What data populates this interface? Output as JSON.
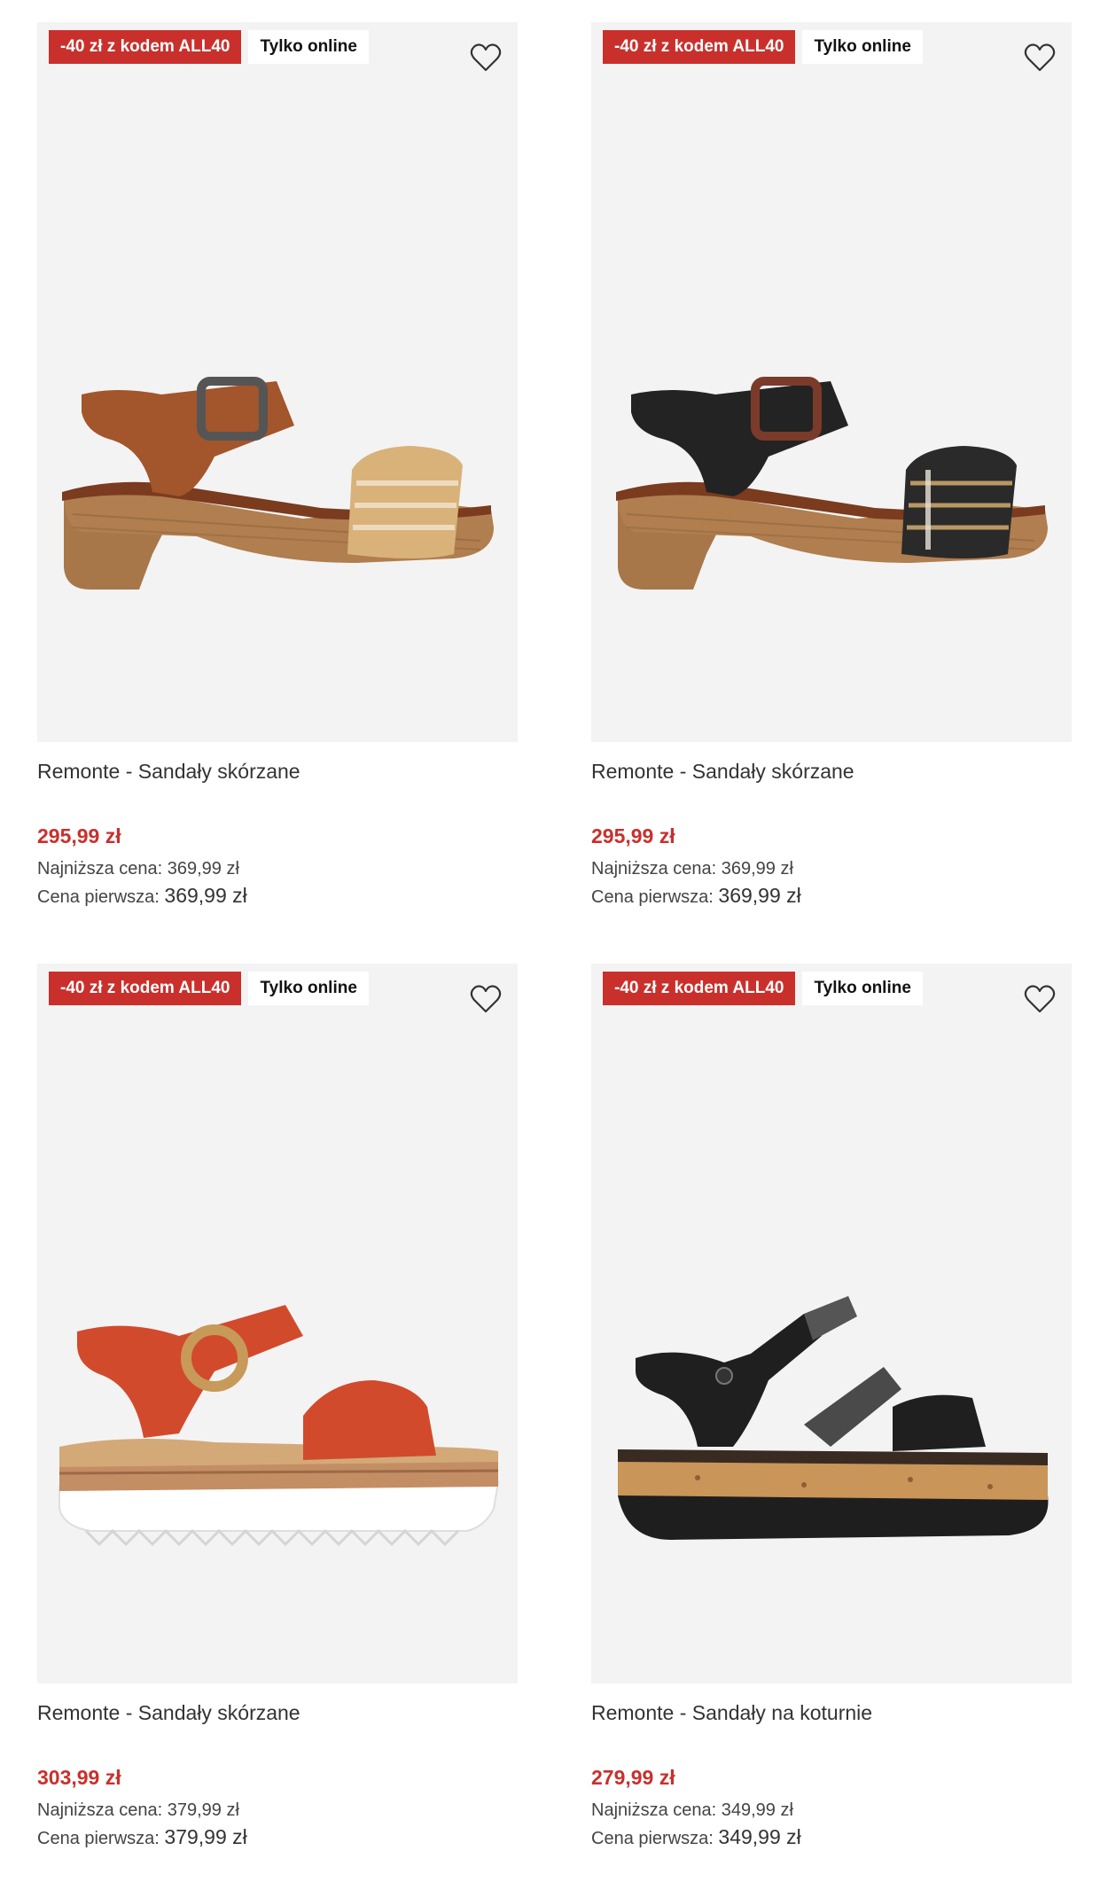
{
  "colors": {
    "promo_badge": "#c9302c",
    "price": "#c9302c",
    "image_bg": "#f3f3f3"
  },
  "products": [
    {
      "promo_badge": "-40 zł z kodem ALL40",
      "online_badge": "Tylko online",
      "wishlist_icon": "heart-outline-icon",
      "title": "Remonte - Sandały skórzane",
      "price": "295,99 zł",
      "lowest_price": "Najniższa cena: 369,99 zł",
      "first_price_label": "Cena pierwsza:",
      "first_price_value": "369,99 zł"
    },
    {
      "promo_badge": "-40 zł z kodem ALL40",
      "online_badge": "Tylko online",
      "wishlist_icon": "heart-outline-icon",
      "title": "Remonte - Sandały skórzane",
      "price": "295,99 zł",
      "lowest_price": "Najniższa cena: 369,99 zł",
      "first_price_label": "Cena pierwsza:",
      "first_price_value": "369,99 zł"
    },
    {
      "promo_badge": "-40 zł z kodem ALL40",
      "online_badge": "Tylko online",
      "wishlist_icon": "heart-outline-icon",
      "title": "Remonte - Sandały skórzane",
      "price": "303,99 zł",
      "lowest_price": "Najniższa cena: 379,99 zł",
      "first_price_label": "Cena pierwsza:",
      "first_price_value": "379,99 zł"
    },
    {
      "promo_badge": "-40 zł z kodem ALL40",
      "online_badge": "Tylko online",
      "wishlist_icon": "heart-outline-icon",
      "title": "Remonte - Sandały na koturnie",
      "price": "279,99 zł",
      "lowest_price": "Najniższa cena: 349,99 zł",
      "first_price_label": "Cena pierwsza:",
      "first_price_value": "349,99 zł"
    }
  ]
}
